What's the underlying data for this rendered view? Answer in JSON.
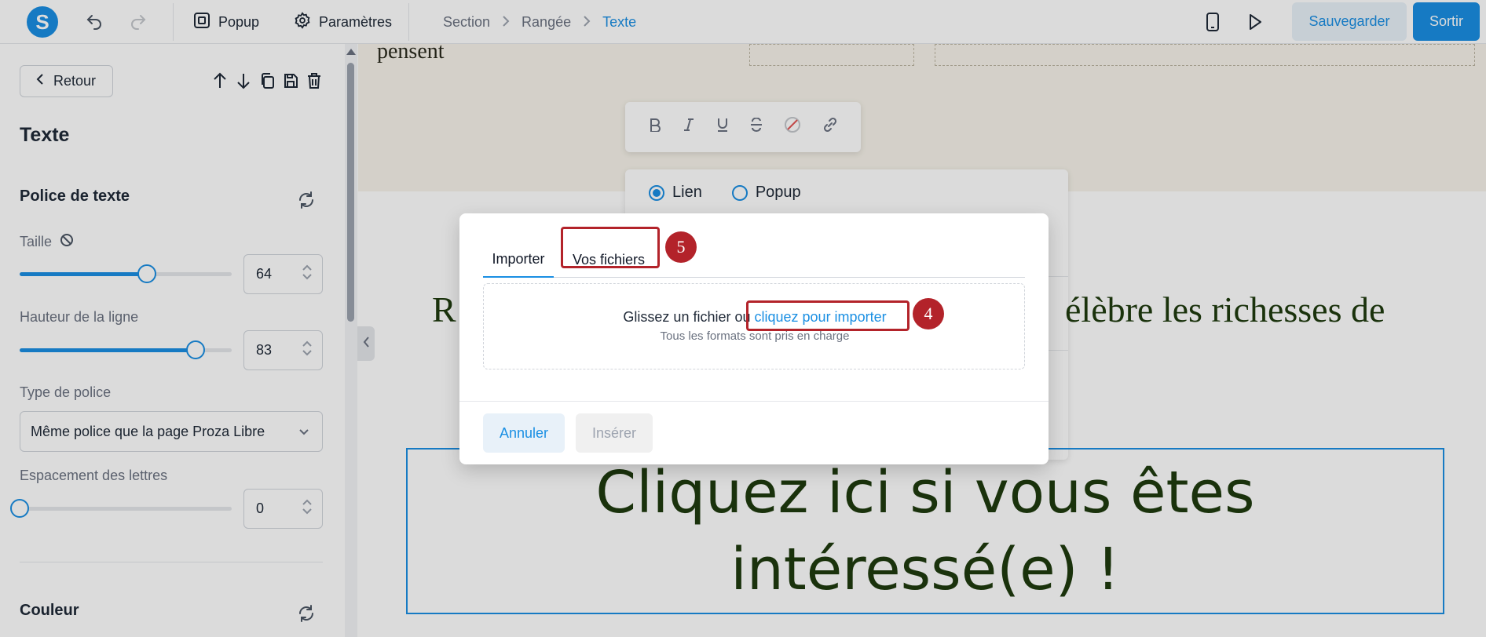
{
  "topbar": {
    "logo_letter": "S",
    "popup_label": "Popup",
    "settings_label": "Paramètres",
    "breadcrumbs": [
      "Section",
      "Rangée",
      "Texte"
    ],
    "save_label": "Sauvegarder",
    "exit_label": "Sortir"
  },
  "panel": {
    "back_label": "Retour",
    "title": "Texte",
    "font_section_title": "Police de texte",
    "size_label": "Taille",
    "size_value": "64",
    "size_level": 0.6,
    "line_height_label": "Hauteur de la ligne",
    "line_height_value": "83",
    "line_height_level": 0.83,
    "font_type_label": "Type de police",
    "font_type_value": "Même police que la page Proza Libre",
    "letter_spacing_label": "Espacement des lettres",
    "letter_spacing_value": "0",
    "letter_spacing_level": 0,
    "color_section_title": "Couleur"
  },
  "canvas": {
    "hero_text": "pensent",
    "mid_text_left": "R",
    "mid_text_right": "élèbre les richesses de",
    "big_text": "Cliquez ici si vous êtes intéressé(e) !",
    "link_panel": {
      "opt_link": "Lien",
      "opt_popup": "Popup"
    }
  },
  "modal": {
    "tab_import": "Importer",
    "tab_files": "Vos fichiers",
    "drop_text": "Glissez un fichier ou ",
    "drop_link": "cliquez pour importer",
    "drop_sub": "Tous les formats sont pris en charge",
    "cancel_label": "Annuler",
    "insert_label": "Insérer"
  },
  "annotations": {
    "badge_files": "5",
    "badge_import": "4"
  },
  "colors": {
    "accent": "#1a8fe3",
    "annotation": "#b3232a",
    "heading_green": "#1f3b0e"
  },
  "icons": [
    "undo-icon",
    "redo-icon",
    "popup-icon",
    "gear-icon",
    "chevron-right-icon",
    "mobile-icon",
    "play-icon",
    "chevron-left-icon",
    "arrow-up-icon",
    "arrow-down-icon",
    "copy-icon",
    "save-icon",
    "trash-icon",
    "refresh-icon",
    "no-icon",
    "stepper-icon",
    "chevron-down-icon",
    "bold-icon",
    "italic-icon",
    "underline-icon",
    "strikethrough-icon",
    "clear-color-icon",
    "link-icon"
  ]
}
